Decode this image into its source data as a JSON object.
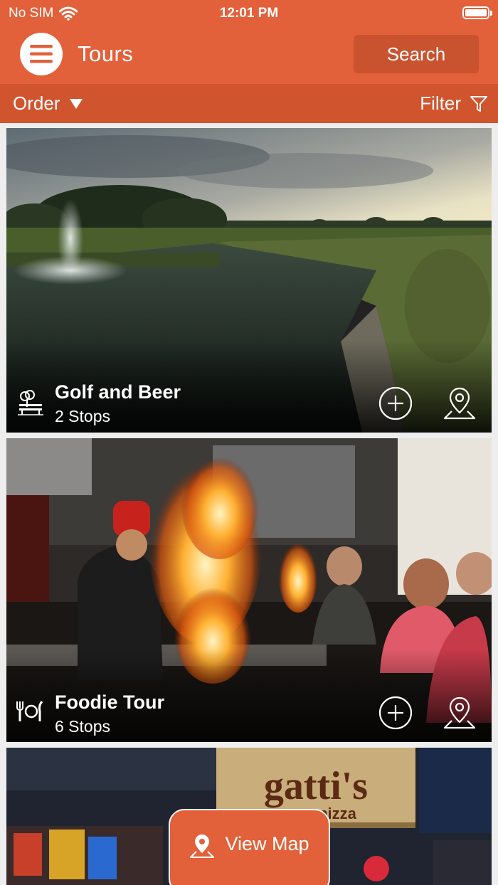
{
  "status": {
    "carrier": "No SIM",
    "time": "12:01 PM"
  },
  "nav": {
    "title": "Tours",
    "search_label": "Search"
  },
  "subbar": {
    "order_label": "Order",
    "filter_label": "Filter"
  },
  "tours": [
    {
      "title": "Golf and Beer",
      "stops": "2 Stops",
      "icon": "park-bench-icon"
    },
    {
      "title": "Foodie Tour",
      "stops": "6 Stops",
      "icon": "dining-icon"
    },
    {
      "title": "",
      "stops": "",
      "icon": ""
    }
  ],
  "third_card_sign": {
    "line1": "gatti's",
    "line2": "pizza"
  },
  "view_map_label": "View Map",
  "colors": {
    "primary": "#e2603a",
    "primary_dark": "#d0552f",
    "search_bg": "#c9532f"
  }
}
